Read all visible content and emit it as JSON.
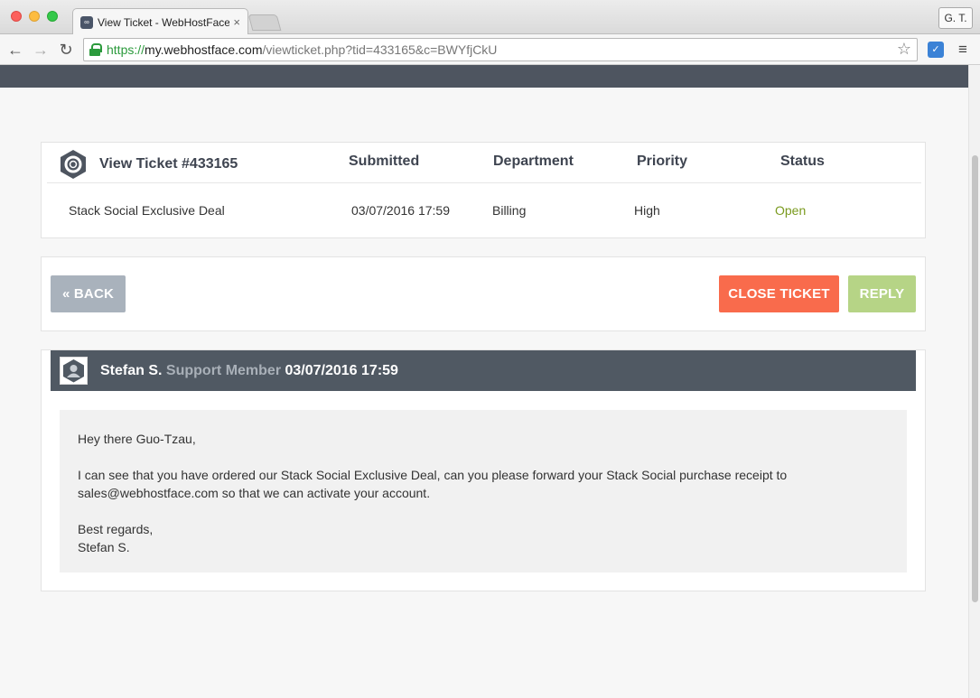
{
  "browser": {
    "tab_title": "View Ticket - WebHostFace",
    "tab_close": "×",
    "profile": "G. T.",
    "url_scheme": "https://",
    "url_host": "my.webhostface.com",
    "url_path": "/viewticket.php?tid=433165&c=BWYfjCkU",
    "back": "←",
    "forward": "→",
    "reload": "↻",
    "star": "☆",
    "menu": "≡"
  },
  "ticket": {
    "title": "View Ticket #433165",
    "headers": {
      "submitted": "Submitted",
      "department": "Department",
      "priority": "Priority",
      "status": "Status"
    },
    "subject": "Stack Social Exclusive Deal",
    "submitted": "03/07/2016 17:59",
    "department": "Billing",
    "priority": "High",
    "status": "Open",
    "status_color": "#7a9a1e"
  },
  "actions": {
    "back": "« BACK",
    "close": "CLOSE TICKET",
    "reply": "REPLY"
  },
  "message": {
    "author": "Stefan S.",
    "role": "Support Member",
    "date": "03/07/2016 17:59",
    "greeting": "Hey there Guo-Tzau,",
    "line1": "I can see that you have ordered our Stack Social Exclusive Deal, can you please forward your Stack Social purchase receipt to",
    "line2": "sales@webhostface.com so that we can activate your account.",
    "closing": "Best regards,",
    "signature": "Stefan S."
  }
}
